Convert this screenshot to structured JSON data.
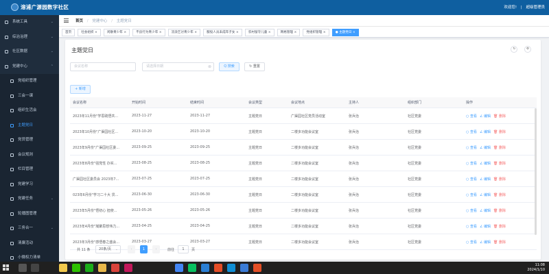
{
  "header": {
    "brand": "溶浦广源园数字社区",
    "welcome": "欢迎您!",
    "separator": "|",
    "user": "超级管理员"
  },
  "sidebar": {
    "items": [
      {
        "label": "系统工具",
        "icon": "wrench-icon",
        "arrow": "⌄"
      },
      {
        "label": "综治治理",
        "icon": "shield-icon",
        "arrow": "⌄"
      },
      {
        "label": "社区数据",
        "icon": "database-icon",
        "arrow": "⌄"
      },
      {
        "label": "党建中心",
        "icon": "flag-icon",
        "arrow": "⌃"
      },
      {
        "label": "党组织管理",
        "icon": "org-icon",
        "arrow": ""
      },
      {
        "label": "三会一课",
        "icon": "book-icon",
        "arrow": ""
      },
      {
        "label": "组织生活会",
        "icon": "meeting-icon",
        "arrow": ""
      },
      {
        "label": "主题党日",
        "icon": "calendar-icon",
        "arrow": ""
      },
      {
        "label": "党员管理",
        "icon": "user-icon",
        "arrow": ""
      },
      {
        "label": "会议规则",
        "icon": "rule-icon",
        "arrow": ""
      },
      {
        "label": "栏目管理",
        "icon": "column-icon",
        "arrow": ""
      },
      {
        "label": "党建学习",
        "icon": "study-icon",
        "arrow": ""
      },
      {
        "label": "党建任务",
        "icon": "task-icon",
        "arrow": "⌄"
      },
      {
        "label": "轮播图管理",
        "icon": "image-icon",
        "arrow": ""
      },
      {
        "label": "三务合一",
        "icon": "merge-icon",
        "arrow": "⌄"
      },
      {
        "label": "清廉活动",
        "icon": "activity-icon",
        "arrow": ""
      },
      {
        "label": "小微权力清单",
        "icon": "list-icon",
        "arrow": ""
      }
    ]
  },
  "breadcrumb": {
    "home": "首页",
    "level1": "党建中心",
    "level2": "主题党日",
    "sep": "/"
  },
  "tags": [
    "首页",
    "社会组织 ×",
    "闲散青少年 ×",
    "不良行为青少年 ×",
    "流浪乞讨青少年 ×",
    "服役人员未成年子女 ×",
    "农村留守儿童 ×",
    "网格管理 ×",
    "党组织管理 ×",
    "● 主题党日 ×"
  ],
  "page": {
    "title": "主题党日",
    "refresh_icon": "↻",
    "column_icon": "⚙"
  },
  "search": {
    "name_placeholder": "会议名称",
    "date_placeholder": "请选择日期",
    "search_label": "Q 搜索",
    "reset_label": "↻ 重置",
    "add_label": "+ 新增"
  },
  "table": {
    "headers": [
      "会议名称",
      "开始时间",
      "结束时间",
      "会议类型",
      "会议地点",
      "主持人",
      "组织部门",
      "操作"
    ],
    "rows": [
      [
        "2023年11月份\"学思践悟共...",
        "2023-11-27",
        "2023-11-27",
        "主题党日",
        "广渠园社区党员活动室",
        "张兵治",
        "社区党委"
      ],
      [
        "2023年10月份\"广渠园社区...",
        "2023-10-20",
        "2023-10-20",
        "主题党日",
        "二楼多功能会议室",
        "张兵治",
        "社区党委"
      ],
      [
        "2023年9月份\"广渠园社区委...",
        "2023-09-25",
        "2023-09-25",
        "主题党日",
        "二楼多功能会议室",
        "张兵治",
        "社区党委"
      ],
      [
        "2023年8月份\"强党性 办实...",
        "2023-08-25",
        "2023-08-25",
        "主题党日",
        "二楼多功能会议室",
        "张兵治",
        "社区党委"
      ],
      [
        "广渠园社区委员会 2023年7...",
        "2023-07-25",
        "2023-07-25",
        "主题党日",
        "二楼多功能会议室",
        "张兵治",
        "社区党委"
      ],
      [
        "023年6月份\"学习二十大 贯...",
        "2023-06-30",
        "2023-06-30",
        "主题党日",
        "二楼多功能会议室",
        "张兵治",
        "社区党委"
      ],
      [
        "2023年5月份\"悟初心 担使...",
        "2023-05-26",
        "2023-05-26",
        "主题党日",
        "二楼多功能会议室",
        "张兵治",
        "社区党委"
      ],
      [
        "2023年4月份\"凝聚思想伟力...",
        "2023-04-25",
        "2023-04-25",
        "主题党日",
        "二楼多功能会议室",
        "张兵治",
        "社区党委"
      ],
      [
        "2023年3月份\"感悟春之盛会...",
        "2023-03-27",
        "2023-03-27",
        "主题党日",
        "二楼多功能会议室",
        "张兵治",
        "社区党委"
      ]
    ],
    "actions": {
      "view": "○ 查看",
      "edit": "∠ 编辑",
      "delete": "🗑 删除"
    }
  },
  "pagination": {
    "total": "共 11 条",
    "page_size": "20条/页",
    "dropdown": "⌄",
    "prev": "‹",
    "current": "1",
    "next": "›",
    "goto": "前往",
    "goto_value": "1",
    "page_suffix": "页"
  },
  "taskbar": {
    "time": "11:08",
    "date": "2024/1/10",
    "icons": [
      {
        "name": "search-icon",
        "color": "#555555"
      },
      {
        "name": "task-view-icon",
        "color": "#444444"
      },
      {
        "name": "file-explorer-icon",
        "color": "#f2c94c"
      },
      {
        "name": "wechat-icon",
        "color": "#2dc100"
      },
      {
        "name": "messenger-icon",
        "color": "#1aad19"
      },
      {
        "name": "folder-icon",
        "color": "#e8b84a"
      },
      {
        "name": "app-red-icon",
        "color": "#d9433b"
      },
      {
        "name": "app-pink-icon",
        "color": "#c2185b"
      },
      {
        "name": "chrome-icon",
        "color": "#4285f4"
      },
      {
        "name": "wechat-devtools-icon",
        "color": "#07c160"
      },
      {
        "name": "vscode-icon",
        "color": "#2a7fd4"
      },
      {
        "name": "html-icon",
        "color": "#e44d26"
      },
      {
        "name": "edge-icon",
        "color": "#0f8ed4"
      },
      {
        "name": "app-blue-icon",
        "color": "#3a7bd5"
      },
      {
        "name": "html5-icon",
        "color": "#e34f26"
      }
    ]
  },
  "colors": {
    "header": "#0f5fa0",
    "sidebar": "#1f2d3d",
    "primary": "#409eff",
    "danger": "#f56c6c"
  }
}
